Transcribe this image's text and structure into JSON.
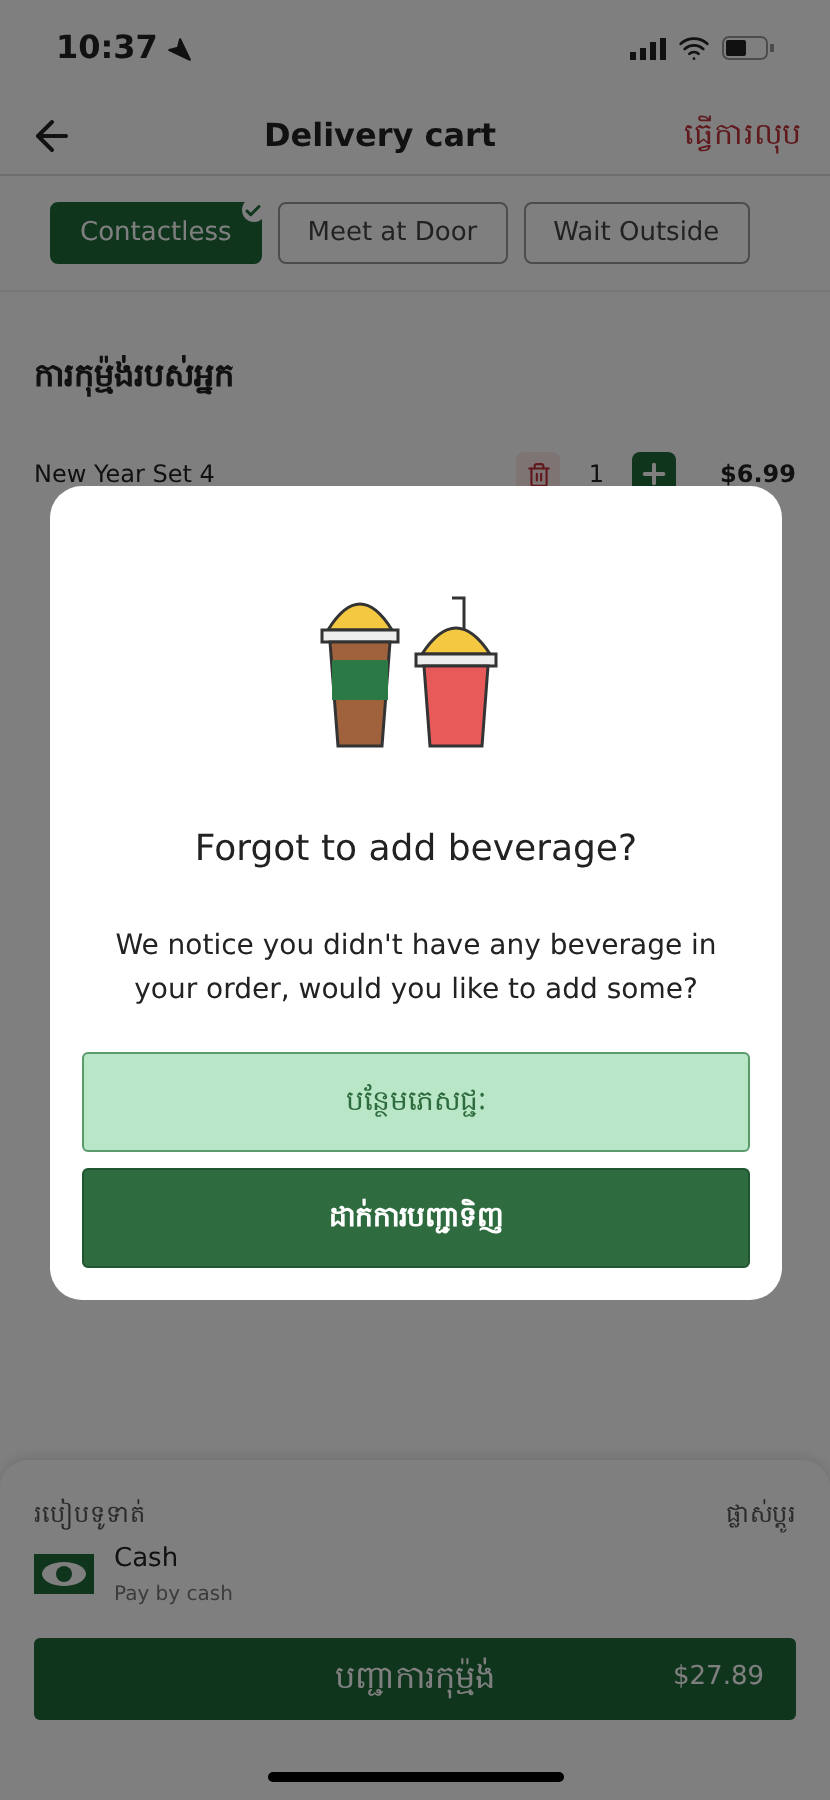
{
  "status_bar": {
    "time": "10:37"
  },
  "header": {
    "title": "Delivery cart",
    "action": "ធ្វើការលុប"
  },
  "delivery_options": [
    {
      "label": "Contactless",
      "selected": true
    },
    {
      "label": "Meet at Door",
      "selected": false
    },
    {
      "label": "Wait Outside",
      "selected": false
    }
  ],
  "order": {
    "title": "ការកុម្ម៉ង់របស់អ្នក",
    "items": [
      {
        "name": "New Year Set 4",
        "quantity": "1",
        "price": "$6.99"
      }
    ]
  },
  "payment": {
    "label": "របៀបទូទាត់",
    "change": "ផ្លាស់ប្តូរ",
    "method": "Cash",
    "method_note": "Pay by cash"
  },
  "checkout": {
    "label": "បញ្ជាការកុម្ម៉ង់",
    "total": "$27.89"
  },
  "dialog": {
    "title": "Forgot to add beverage?",
    "message": "We notice you didn't have any beverage in your order, would you like to add some?",
    "buttons": [
      {
        "label": "បន្ថែមភេសជ្ជៈ",
        "kind": "secondary"
      },
      {
        "label": "ដាក់ការបញ្ជាទិញ",
        "kind": "primary"
      }
    ]
  }
}
